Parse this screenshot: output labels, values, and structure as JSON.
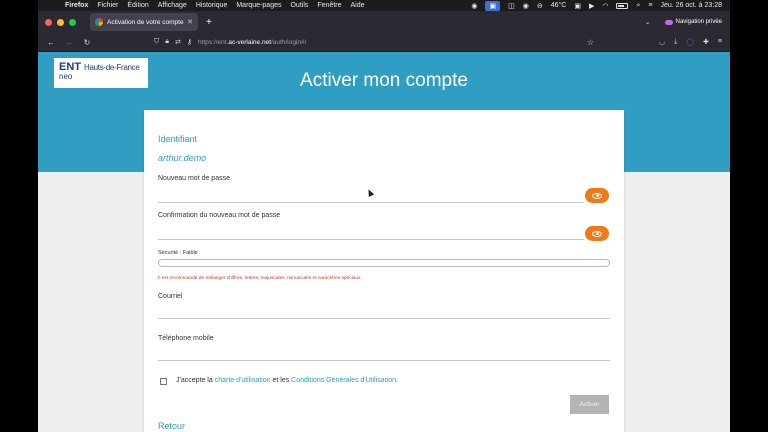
{
  "menubar": {
    "app": "Firefox",
    "items": [
      "Fichier",
      "Édition",
      "Affichage",
      "Historique",
      "Marque-pages",
      "Outils",
      "Fenêtre",
      "Aide"
    ],
    "temperature": "46°C",
    "datetime": "Jeu. 26 oct. à 23:28"
  },
  "browser": {
    "tab_title": "Activation de votre compte",
    "new_tab": "+",
    "url_prefix": "https://ent.",
    "url_domain": "ac-verlaine.net",
    "url_path": "/auth/login#/",
    "private_label": "Navigation privée"
  },
  "logo": {
    "ent": "ENT",
    "region": "Hauts-de-France",
    "brand": "neo"
  },
  "page": {
    "title": "Activer mon compte"
  },
  "form": {
    "identifiant_label": "Identifiant",
    "identifiant_value": "arthur.demo",
    "new_password_label": "Nouveau mot de passe",
    "confirm_password_label": "Confirmation du nouveau mot de passe",
    "security_label": "Sécurité : Faible",
    "security_level": 0,
    "warning": "Il est recommandé de mélanger chiffres, lettres, majuscules, minuscules et caractères spéciaux.",
    "email_label": "Courriel",
    "phone_label": "Téléphone mobile",
    "accept_prefix": "J'accepte la ",
    "accept_link1": "charte d'utilisation",
    "accept_mid": " et les ",
    "accept_link2": "Conditions Générales d'Utilisation",
    "accept_suffix": ".",
    "submit_label": "Activer",
    "back_label": "Retour"
  },
  "colors": {
    "brand_blue": "#2f9ec2",
    "eye_orange": "#f07a1a",
    "warning_red": "#c0392b",
    "disabled_button": "#b4b4b4"
  }
}
